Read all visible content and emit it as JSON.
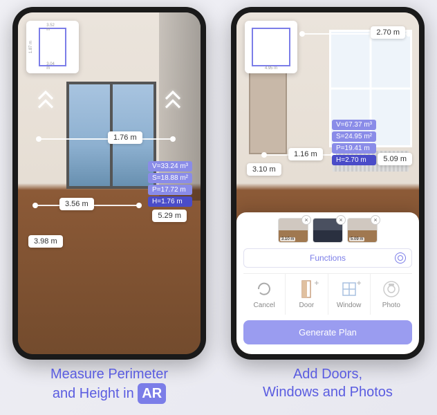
{
  "left": {
    "minimap": {
      "top": "3.52 m",
      "bottom": "3.04 m",
      "side": "1.87 m"
    },
    "measurements": {
      "topWidth": "1.76 m",
      "midWidth": "3.56 m",
      "rightDepth": "5.29 m",
      "leftDepth": "3.98 m"
    },
    "stats": {
      "volume": "V=33.24 m³",
      "area": "S=18.88 m²",
      "perimeter": "P=17.72 m",
      "height": "H=1.76 m"
    },
    "caption_line1": "Measure Perimeter",
    "caption_line2": "and Height in",
    "caption_badge": "AR"
  },
  "right": {
    "minimap": {
      "bottom": "4.95 m"
    },
    "measurements": {
      "topWidth": "2.70 m",
      "midWidth": "1.16 m",
      "leftHeight": "3.10 m",
      "rightDepth": "5.09 m"
    },
    "stats": {
      "volume": "V=67.37 m³",
      "area": "S=24.95 m²",
      "perimeter": "P=19.41 m",
      "height": "H=2.70 m"
    },
    "thumbs": [
      {
        "label": "3.10 m"
      },
      {
        "label": ""
      },
      {
        "label": "5.09 m"
      }
    ],
    "functions_title": "Functions",
    "fn": {
      "cancel": "Cancel",
      "door": "Door",
      "window": "Window",
      "photo": "Photo"
    },
    "generate": "Generate Plan",
    "caption_line1": "Add Doors,",
    "caption_line2": "Windows and Photos"
  }
}
